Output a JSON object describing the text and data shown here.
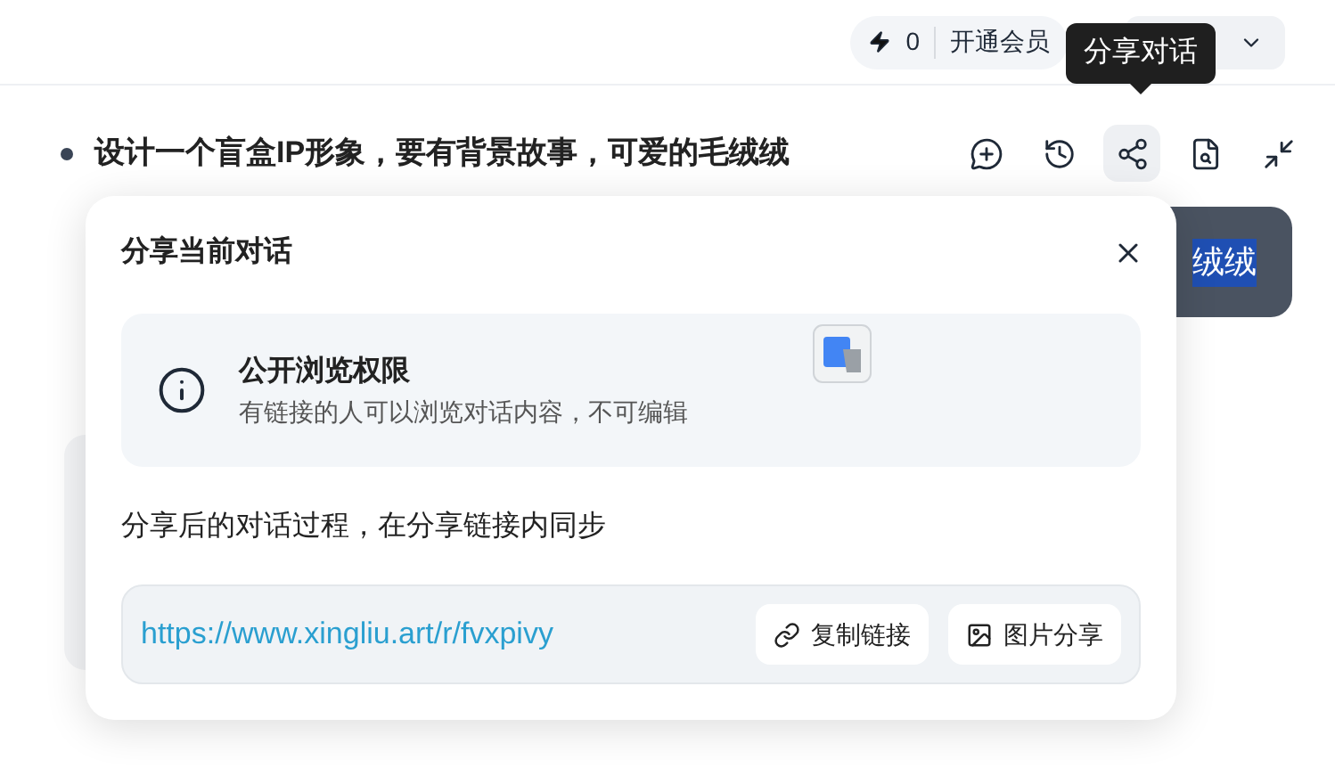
{
  "header": {
    "credits": "0",
    "vip_button": "开通会员"
  },
  "tooltip": "分享对话",
  "conversation": {
    "title": "设计一个盲盒IP形象，要有背景故事，可爱的毛绒绒",
    "toolbar": [
      {
        "kind": "new-chat",
        "selected": false
      },
      {
        "kind": "history",
        "selected": false
      },
      {
        "kind": "share",
        "selected": true
      },
      {
        "kind": "document",
        "selected": false
      },
      {
        "kind": "collapse",
        "selected": false
      }
    ],
    "bubble_text": "绒绒"
  },
  "share_dialog": {
    "title": "分享当前对话",
    "permission": {
      "title": "公开浏览权限",
      "description": "有链接的人可以浏览对话内容，不可编辑"
    },
    "note": "分享后的对话过程，在分享链接内同步",
    "link": "https://www.xingliu.art/r/fvxpivy",
    "buttons": [
      {
        "kind": "copy",
        "label": "复制链接"
      },
      {
        "kind": "image",
        "label": "图片分享"
      }
    ]
  }
}
